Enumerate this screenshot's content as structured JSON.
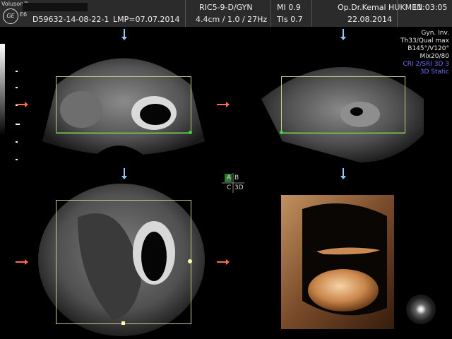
{
  "header": {
    "brand": "Voluson™",
    "model": "E6",
    "logo": "GE",
    "patient_id": "D59632-14-08-22-1",
    "lmp": "LMP=07.07.2014",
    "probe": "RIC5-9-D/GYN",
    "depth_info": "4.4cm / 1.0 / 27Hz",
    "mi": "MI  0.9",
    "tis": "TIs  0.7",
    "operator": "Op.Dr.Kemal HUKMEN",
    "date": "22.08.2014",
    "time": "11:03:05"
  },
  "right_info": {
    "lines": [
      "Gyn. Inv.",
      "Th33/Qual max",
      "B145°/V120°",
      "Mix20/80"
    ],
    "blue_lines": [
      "CRI 2/SRI 3D 3",
      "3D Static"
    ]
  },
  "quad_labels": {
    "a": "A",
    "b": "B",
    "c": "C",
    "d": "3D"
  },
  "icons": {
    "orientation_arrow": "red-arrow-icon",
    "slice_arrow": "blue-arrow-icon",
    "light_source": "light-source-icon"
  },
  "colors": {
    "header_bg": "#2b2b2b",
    "roi_frame": "#c9c98a",
    "marker_red": "#ff6a4a",
    "marker_blue": "#8ecbff",
    "plane_green": "#2c9a2c",
    "render_orange": "#d99a5a"
  }
}
